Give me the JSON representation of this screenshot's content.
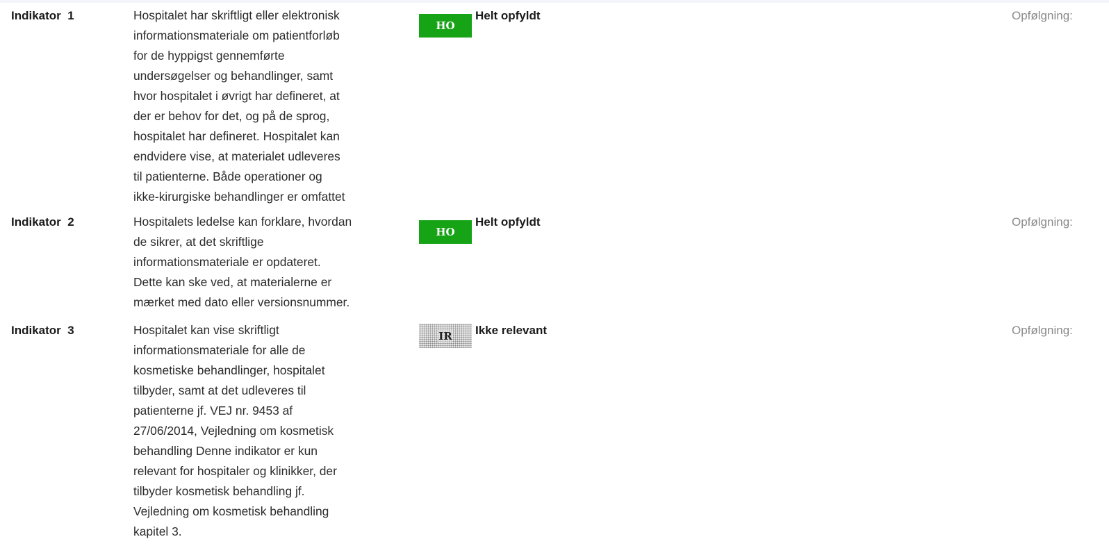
{
  "indicators": [
    {
      "label": "Indikator  1",
      "text": "Hospitalet har skriftligt eller elektronisk\ninformationsmateriale om patientforløb\nfor de hyppigst gennemførte\nundersøgelser og behandlinger, samt\nhvor hospitalet i øvrigt har defineret, at\nder er behov for det, og på de sprog,\nhospitalet har defineret. Hospitalet kan\nendvidere vise, at materialet udleveres\ntil patienterne.   Både operationer og\nikke-kirurgiske behandlinger er omfattet",
      "badge": "HO",
      "status": "Helt opfyldt",
      "followup": "Opfølgning:"
    },
    {
      "label": "Indikator  2",
      "text": "Hospitalets ledelse kan forklare, hvordan\nde sikrer, at det skriftlige\ninformationsmateriale er opdateret.\nDette kan ske ved, at materialerne er\nmærket med dato eller versionsnummer.",
      "badge": "HO",
      "status": "Helt opfyldt",
      "followup": "Opfølgning:"
    },
    {
      "label": "Indikator  3",
      "text": "Hospitalet kan vise skriftligt\ninformationsmateriale for alle de\nkosmetiske behandlinger, hospitalet\ntilbyder, samt at det udleveres til\npatienterne jf. VEJ nr. 9453 af\n27/06/2014, Vejledning om kosmetisk\nbehandling     Denne indikator er kun\nrelevant for hospitaler og klinikker, der\ntilbyder kosmetisk behandling jf.\nVejledning om kosmetisk behandling\nkapitel 3.",
      "badge": "IR",
      "status": "Ikke relevant",
      "followup": "Opfølgning:"
    }
  ],
  "colors": {
    "badge_ho": "#16a316",
    "badge_ir_pattern": "#8c8c8c",
    "followup_text": "#8a8a8a"
  }
}
